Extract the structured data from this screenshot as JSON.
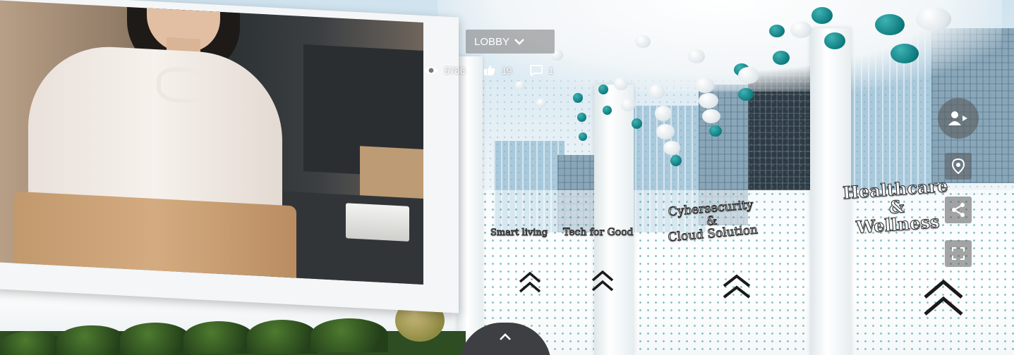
{
  "header": {
    "location_label": "LOBBY"
  },
  "stats": {
    "views": "5786",
    "likes": "19",
    "comments": "1"
  },
  "booths": [
    {
      "label": "Smart living"
    },
    {
      "label": "Tech for Good"
    },
    {
      "label_line1": "Cybersecurity",
      "label_line2": "&",
      "label_line3": "Cloud Solution"
    },
    {
      "label_line1": "Healthcare",
      "label_line2": "&",
      "label_line3": "Wellness"
    }
  ],
  "side_controls": [
    {
      "icon": "avatar-presenter-icon"
    },
    {
      "icon": "location-pin-icon"
    },
    {
      "icon": "share-icon"
    },
    {
      "icon": "fullscreen-icon"
    }
  ],
  "bottom_tab": {
    "icon": "chevron-up-icon"
  },
  "colors": {
    "accent_teal": "#0e7b7f",
    "button_bg": "#5a5a5a",
    "bottom_tab_bg": "#3e3f42"
  }
}
